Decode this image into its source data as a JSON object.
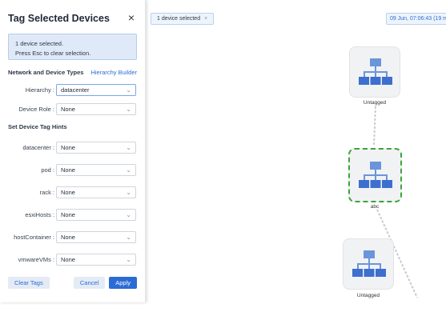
{
  "panel": {
    "title": "Tag Selected Devices",
    "close_icon": "close-icon",
    "info_line1": "1 device selected.",
    "info_line2": "Press Esc to clear selection.",
    "network_section_title": "Network and Device Types",
    "hierarchy_builder_link": "Hierarchy Builder",
    "hierarchy": {
      "label": "Hierarchy :",
      "value": "datacenter"
    },
    "device_role": {
      "label": "Device Role :",
      "value": "None"
    },
    "hints_title": "Set Device Tag Hints",
    "hints": [
      {
        "label": "datacenter :",
        "value": "None"
      },
      {
        "label": "pod :",
        "value": "None"
      },
      {
        "label": "rack :",
        "value": "None"
      },
      {
        "label": "esxiHosts :",
        "value": "None"
      },
      {
        "label": "hostContainer :",
        "value": "None"
      },
      {
        "label": "vmwareVMs :",
        "value": "None"
      }
    ],
    "clear_tags_label": "Clear Tags",
    "cancel_label": "Cancel",
    "apply_label": "Apply"
  },
  "canvas": {
    "selection_chip": "1 device selected",
    "selection_chip_close": "×",
    "timestamp": "09 Jun, 07:06:43 (19 m",
    "nodes": [
      {
        "label": "Untagged",
        "icon": "hierarchy-icon",
        "selected": false
      },
      {
        "label": "abc",
        "icon": "hierarchy-icon",
        "selected": true
      },
      {
        "label": "Untagged",
        "icon": "hierarchy-icon",
        "selected": false
      }
    ]
  },
  "colors": {
    "accent": "#2b6cd4",
    "info_background": "#dfe9f8",
    "selection_dash": "#3aa537",
    "node_icon": "#6b95db",
    "link": "#c8cbd0"
  }
}
